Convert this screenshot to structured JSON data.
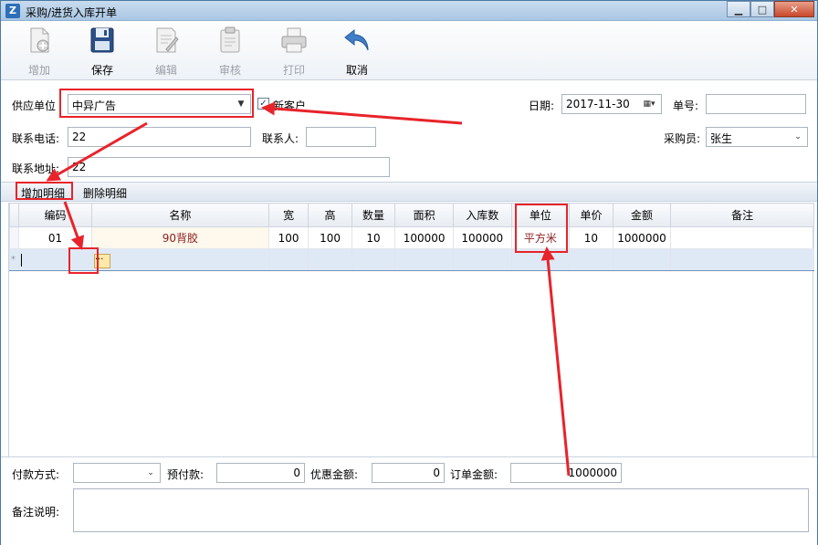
{
  "window": {
    "title": "采购/进货入库开单",
    "app_icon_letter": "Z",
    "minimize_icon": "minimize-icon",
    "maximize_icon": "maximize-icon",
    "close_icon": "close-icon"
  },
  "toolbar": {
    "add_label": "增加",
    "save_label": "保存",
    "edit_label": "编辑",
    "review_label": "审核",
    "print_label": "打印",
    "cancel_label": "取消"
  },
  "form": {
    "supplier_label": "供应单位",
    "supplier_value": "中异广告",
    "new_customer_label": "新客户",
    "new_customer_checked": true,
    "date_label": "日期:",
    "date_value": "2017-11-30",
    "order_no_label": "单号:",
    "order_no_value": "",
    "phone_label": "联系电话:",
    "phone_value": "22",
    "contact_label": "联系人:",
    "contact_value": "",
    "buyer_label": "采购员:",
    "buyer_value": "张生",
    "address_label": "联系地址:",
    "address_value": "22"
  },
  "detail": {
    "add_detail_label": "增加明细",
    "delete_detail_label": "删除明细",
    "columns": [
      "编码",
      "名称",
      "宽",
      "高",
      "数量",
      "面积",
      "入库数",
      "单位",
      "单价",
      "金额",
      "备注"
    ],
    "rows": [
      {
        "code": "01",
        "name": "90背胶",
        "width": "100",
        "height": "100",
        "qty": "10",
        "area": "100000",
        "in_qty": "100000",
        "unit": "平方米",
        "price": "10",
        "amount": "1000000",
        "note": ""
      }
    ],
    "new_row_marker": "*",
    "ellipsis": "···"
  },
  "footer": {
    "payment_label": "付款方式:",
    "payment_value": "",
    "prepay_label": "预付款:",
    "prepay_value": "0",
    "discount_label": "优惠金额:",
    "discount_value": "0",
    "order_amount_label": "订单金额:",
    "order_amount_value": "1000000",
    "remark_label": "备注说明:",
    "remark_value": ""
  },
  "colors": {
    "annotation": "#e8232a",
    "title_bar": "#b8d0ea",
    "name_text": "#8b1e1e"
  }
}
